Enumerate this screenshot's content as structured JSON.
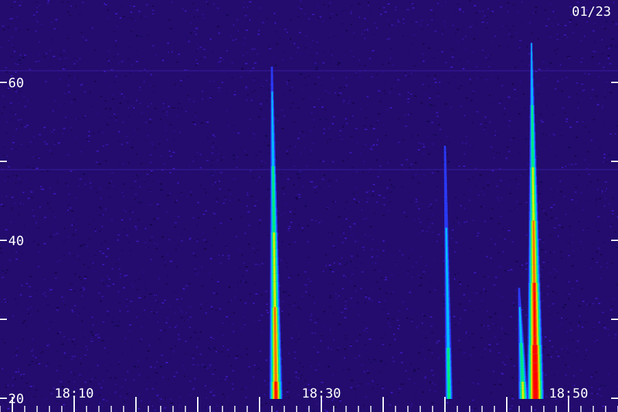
{
  "chart_data": {
    "type": "heatmap",
    "title": "",
    "xlabel": "",
    "ylabel": "",
    "date_label": "01/23",
    "x_tick_labels": [
      "18:10",
      "18:30",
      "18:50"
    ],
    "y_tick_labels": [
      "20",
      "40",
      "60"
    ],
    "y_major_ticks": [
      20,
      30,
      40,
      50,
      60
    ],
    "y_tick_label_values": [
      20,
      40,
      60
    ],
    "x_major_minutes": [
      "18:05",
      "18:10",
      "18:15",
      "18:20",
      "18:25",
      "18:30",
      "18:35",
      "18:40",
      "18:45",
      "18:50",
      "18:55"
    ],
    "xlim": [
      "18:04",
      "18:54"
    ],
    "ylim": [
      20,
      62
    ],
    "colorscale": [
      "#1e0a64",
      "#3c10aa",
      "#2a3dff",
      "#00c8ff",
      "#00f06e",
      "#e6f000",
      "#ff6a00",
      "#ff0000"
    ],
    "bursts": [
      {
        "time": "18:26",
        "f_start": 62,
        "f_end": 20,
        "intensity": 0.75
      },
      {
        "time": "18:40",
        "f_start": 52,
        "f_end": 20,
        "intensity": 0.35
      },
      {
        "time": "18:46",
        "f_start": 34,
        "f_end": 20,
        "intensity": 0.5
      },
      {
        "time": "18:47",
        "f_start": 65,
        "f_end": 20,
        "intensity": 1.0
      }
    ]
  }
}
